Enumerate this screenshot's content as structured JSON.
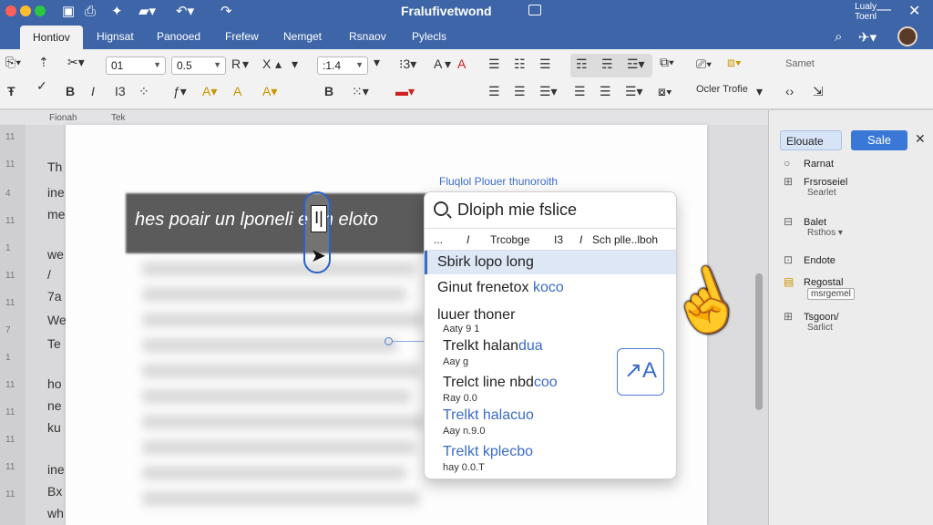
{
  "window": {
    "title": "Fralufivetwond",
    "top_right_label": "Lualy\nToenl",
    "quick_access_icons": [
      "save-icon",
      "print-icon",
      "share-icon",
      "folder-icon",
      "undo-icon",
      "redo-icon"
    ],
    "traffic_colors": [
      "#ff5f57",
      "#febc2e",
      "#28c840"
    ]
  },
  "tabs": [
    {
      "label": "Hontiov",
      "active": true
    },
    {
      "label": "Hignsat",
      "active": false
    },
    {
      "label": "Panooed",
      "active": false
    },
    {
      "label": "Frefew",
      "active": false
    },
    {
      "label": "Nemget",
      "active": false
    },
    {
      "label": "Rsnaov",
      "active": false
    },
    {
      "label": "Pylecls",
      "active": false
    }
  ],
  "ribbon": {
    "font_name_value": "01",
    "font_size_value": "0.5",
    "style_value": ":1.4",
    "r_label": "R",
    "x_label": "X",
    "a_label": "A",
    "b_label": "B",
    "i_label": "I3",
    "style_text": "Ocler Trofie",
    "styles_pane_label": "Samet"
  },
  "ruler": {
    "left": "Fionah",
    "mid": "Tek"
  },
  "left_margin_numbers": [
    "11",
    "11",
    "4",
    "11",
    "1",
    "11",
    "11",
    "7",
    "1",
    "11",
    "11",
    "11",
    "11",
    "11"
  ],
  "behind_page_text": [
    "Th",
    "ine",
    "me",
    "we",
    "/",
    "7a",
    "We",
    "Te",
    "ho",
    "ne",
    "ku",
    "ine",
    "Bx",
    "wh"
  ],
  "document": {
    "selected_text": "hes poair un lponeli e un eloto",
    "caret_char": "I|"
  },
  "popup": {
    "header": "Fluqlol Plouer thunoroith",
    "search_value": "Dloiph mie fslice",
    "format_items": [
      "...",
      "I",
      "Trcobge",
      "I3",
      "I",
      "Sch plle..lboh"
    ],
    "suggestions": [
      {
        "main": "Sbirk lopo long",
        "sub": "",
        "highlight": true
      },
      {
        "main": "Ginut frenetox",
        "blue": "koco",
        "sub": ""
      },
      {
        "main": "luuer thoner",
        "sub": "Aaty 9 1"
      },
      {
        "main": "Trelkt halan",
        "blue": "dua",
        "sub": "Aay g"
      },
      {
        "main": "Trelct line nbd",
        "blue": "coo",
        "sub": "Ray 0.0"
      },
      {
        "main": "Trelkt hal",
        "blue": "acuo",
        "sub": "Aay n.9.0"
      },
      {
        "main": "Trelkt kplec",
        "blue": "bo",
        "sub": "hay 0.0.T"
      }
    ],
    "translate_icon": "translate-icon"
  },
  "right_pane": {
    "tab_label": "Elouate",
    "save_label": "Sale",
    "items": [
      {
        "label": "Rarnat",
        "sub": ""
      },
      {
        "label": "Frsroseiel",
        "sub": "Searlet"
      },
      {
        "label": "Balet",
        "sub": "Rsthos ▾"
      },
      {
        "label": "Endote",
        "sub": ""
      },
      {
        "label": "Regostal",
        "field": "msrgemel"
      },
      {
        "label": "Tsgoon/",
        "sub": "Sarlict"
      }
    ]
  }
}
